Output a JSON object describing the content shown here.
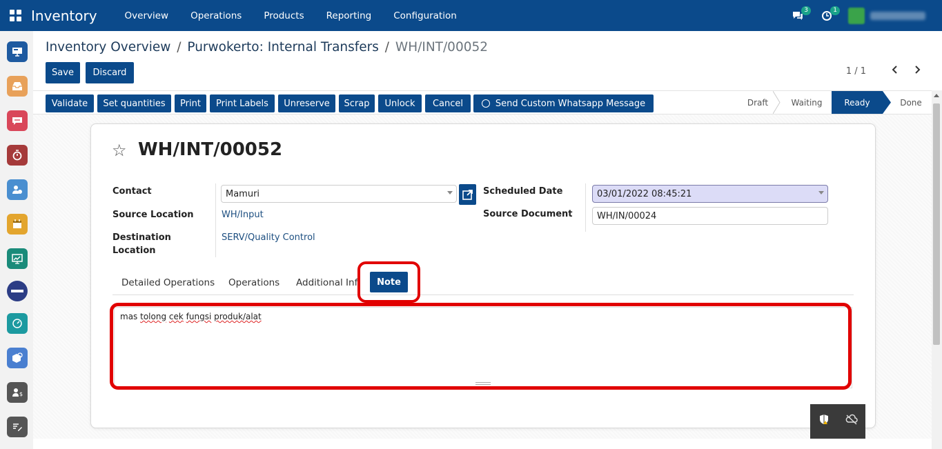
{
  "navbar": {
    "app_name": "Inventory",
    "menu": [
      "Overview",
      "Operations",
      "Products",
      "Reporting",
      "Configuration"
    ],
    "messages_count": "3",
    "activities_count": "1",
    "colors": {
      "bar": "#0b4a8b"
    }
  },
  "sidebar": {
    "icons": [
      {
        "name": "presentation-icon",
        "color": "#1e5aa0"
      },
      {
        "name": "inbox-icon",
        "color": "#e8a15a"
      },
      {
        "name": "chat-icon",
        "color": "#d9475a"
      },
      {
        "name": "stopwatch-icon",
        "color": "#a53a3a"
      },
      {
        "name": "user-clock-icon",
        "color": "#4a8fd0"
      },
      {
        "name": "calendar-icon",
        "color": "#e3a52e"
      },
      {
        "name": "chart-board-icon",
        "color": "#1a8b7a"
      },
      {
        "name": "warranty-badge-icon",
        "color": "#2c3d85"
      },
      {
        "name": "dashboard-icon",
        "color": "#1c9aa0"
      },
      {
        "name": "box-search-icon",
        "color": "#4a7fd0"
      },
      {
        "name": "user-dollar-icon",
        "color": "#555555"
      },
      {
        "name": "edit-icon",
        "color": "#555555"
      }
    ]
  },
  "breadcrumb": {
    "first": "Inventory Overview",
    "second": "Purwokerto: Internal Transfers",
    "current": "WH/INT/00052",
    "separator": "/"
  },
  "controls": {
    "save": "Save",
    "discard": "Discard",
    "pager": "1 / 1"
  },
  "actions": [
    "Validate",
    "Set quantities",
    "Print",
    "Print Labels",
    "Unreserve",
    "Scrap",
    "Unlock",
    "Cancel",
    "Send Custom Whatsapp Message"
  ],
  "stages": {
    "list": [
      "Draft",
      "Waiting",
      "Ready",
      "Done"
    ],
    "current": "Ready"
  },
  "record": {
    "title": "WH/INT/00052",
    "contact_label": "Contact",
    "contact_value": "Mamuri",
    "source_location_label": "Source Location",
    "source_location_value": "WH/Input",
    "destination_location_label_line1": "Destination",
    "destination_location_label_line2": "Location",
    "destination_location_value": "SERV/Quality Control",
    "scheduled_date_label": "Scheduled Date",
    "scheduled_date_value": "03/01/2022 08:45:21",
    "source_document_label": "Source Document",
    "source_document_value": "WH/IN/00024"
  },
  "tabs": {
    "list": [
      "Detailed Operations",
      "Operations",
      "Additional Info",
      "Note"
    ],
    "active": "Note"
  },
  "note": {
    "words": [
      "mas",
      "tolong",
      "cek",
      "fungsi",
      "produk/alat"
    ]
  }
}
